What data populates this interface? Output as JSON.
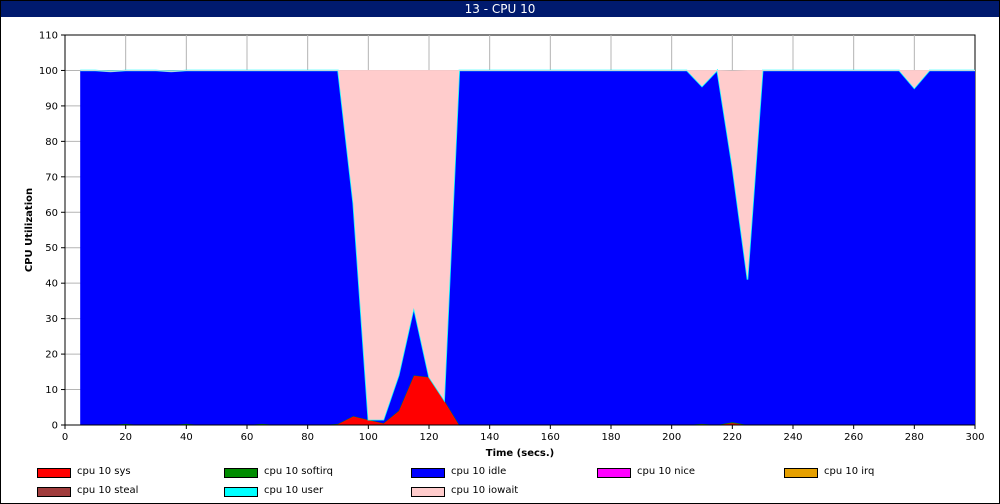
{
  "window": {
    "title": "13 - CPU 10"
  },
  "chart_data": {
    "type": "area",
    "stacked": true,
    "title": "13 - CPU 10",
    "xlabel": "Time (secs.)",
    "ylabel": "CPU Utilization",
    "xlim": [
      0,
      300
    ],
    "ylim": [
      0,
      110
    ],
    "xticks": [
      0,
      20,
      40,
      60,
      80,
      100,
      120,
      140,
      160,
      180,
      200,
      220,
      240,
      260,
      280,
      300
    ],
    "yticks": [
      0,
      10,
      20,
      30,
      40,
      50,
      60,
      70,
      80,
      90,
      100,
      110
    ],
    "grid": true,
    "legend_position": "bottom",
    "x": [
      5,
      10,
      15,
      20,
      25,
      30,
      35,
      40,
      45,
      50,
      55,
      60,
      65,
      70,
      75,
      80,
      85,
      90,
      95,
      100,
      105,
      110,
      115,
      120,
      125,
      130,
      135,
      140,
      145,
      150,
      155,
      160,
      165,
      170,
      175,
      180,
      185,
      190,
      195,
      200,
      205,
      210,
      215,
      220,
      225,
      230,
      235,
      240,
      245,
      250,
      255,
      260,
      265,
      270,
      275,
      280,
      285,
      290,
      295,
      300
    ],
    "series": [
      {
        "name": "cpu 10 sys",
        "color": "#ff0000",
        "values": [
          0,
          0,
          0,
          0,
          0,
          0,
          0,
          0,
          0,
          0,
          0,
          0,
          0,
          0,
          0,
          0,
          0,
          0.3,
          2.5,
          1.5,
          0.5,
          4,
          14,
          13.5,
          7,
          0,
          0,
          0,
          0,
          0,
          0,
          0,
          0,
          0,
          0,
          0,
          0,
          0,
          0,
          0,
          0,
          0.3,
          0,
          0.5,
          0,
          0,
          0,
          0,
          0,
          0,
          0,
          0,
          0,
          0,
          0,
          0,
          0,
          0,
          0,
          0
        ]
      },
      {
        "name": "cpu 10 softirq",
        "color": "#008c00",
        "values": [
          0,
          0,
          0,
          0.3,
          0,
          0,
          0,
          0.3,
          0,
          0,
          0,
          0,
          0.3,
          0,
          0,
          0,
          0,
          0,
          0,
          0,
          0,
          0,
          0,
          0,
          0,
          0,
          0,
          0,
          0,
          0,
          0,
          0,
          0,
          0,
          0,
          0,
          0,
          0,
          0,
          0,
          0,
          0,
          0,
          0.3,
          0,
          0,
          0,
          0,
          0,
          0,
          0,
          0,
          0,
          0,
          0,
          0,
          0,
          0,
          0,
          0
        ]
      },
      {
        "name": "cpu 10 idle",
        "color": "#0000ff",
        "values": [
          100,
          100,
          99.7,
          99.7,
          100,
          100,
          99.7,
          99.7,
          100,
          100,
          100,
          100,
          99.7,
          100,
          100,
          100,
          100,
          99.7,
          60,
          0,
          1,
          10,
          19,
          0,
          0,
          100,
          100,
          100,
          100,
          100,
          100,
          100,
          100,
          100,
          100,
          100,
          100,
          100,
          100,
          100,
          100,
          95.2,
          100,
          72,
          41,
          100,
          100,
          100,
          100,
          100,
          100,
          100,
          100,
          100,
          100,
          95,
          100,
          100,
          100,
          100
        ]
      },
      {
        "name": "cpu 10 nice",
        "color": "#ff00ff",
        "values": []
      },
      {
        "name": "cpu 10 irq",
        "color": "#e6a000",
        "values": []
      },
      {
        "name": "cpu 10 steal",
        "color": "#a03c3c",
        "values": []
      },
      {
        "name": "cpu 10 user",
        "color": "#00ffff",
        "values": [
          0,
          0,
          0,
          0,
          0,
          0,
          0,
          0,
          0,
          0,
          0,
          0,
          0,
          0,
          0,
          0,
          0,
          0,
          0,
          0,
          0,
          0,
          0,
          0,
          0,
          0,
          0,
          0,
          0,
          0,
          0,
          0,
          0,
          0,
          0,
          0,
          0,
          0,
          0,
          0,
          0,
          0,
          0,
          0,
          0,
          0,
          0,
          0,
          0,
          0,
          0,
          0,
          0,
          0,
          0,
          0,
          0,
          0,
          0,
          0
        ]
      },
      {
        "name": "cpu 10 iowait",
        "color": "#ffcccc",
        "values": [
          0,
          0,
          0,
          0,
          0,
          0,
          0,
          0,
          0,
          0,
          0,
          0,
          0,
          0,
          0,
          0,
          0,
          0,
          37.5,
          98.5,
          98.5,
          86,
          67,
          86.5,
          93,
          0,
          0,
          0,
          0,
          0,
          0,
          0,
          0,
          0,
          0,
          0,
          0,
          0,
          0,
          0,
          0,
          4.5,
          0,
          27,
          59,
          0,
          0,
          0,
          0,
          0,
          0,
          0,
          0,
          0,
          0,
          5,
          0,
          0,
          0,
          0
        ]
      }
    ]
  }
}
